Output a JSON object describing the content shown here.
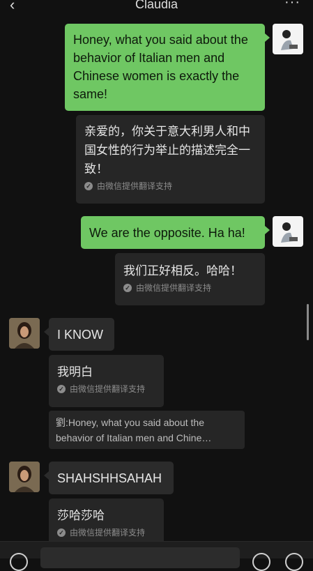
{
  "header": {
    "title": "Claudia",
    "back_icon": "chevron-left-icon",
    "more_icon": "more-dots-icon"
  },
  "messages": {
    "m1": {
      "text": "Honey, what you said about the behavior of Italian men and Chinese women is exactly the same!",
      "translation": "亲爱的，你关于意大利男人和中国女性的行为举止的描述完全一致！"
    },
    "m2": {
      "text": "We are the opposite. Ha ha!",
      "translation": "我们正好相反。哈哈！"
    },
    "m3": {
      "text": "I KNOW",
      "translation": "我明白",
      "quote": "劉:Honey, what you said about the behavior of Italian men and Chine…"
    },
    "m4": {
      "text": "SHAHSHHSAHAH",
      "translation": "莎哈莎哈"
    }
  },
  "translation_credit": "由微信提供翻译支持",
  "colors": {
    "background": "#111111",
    "sent_bubble": "#6fc763",
    "received_bubble": "#2b2b2b"
  }
}
